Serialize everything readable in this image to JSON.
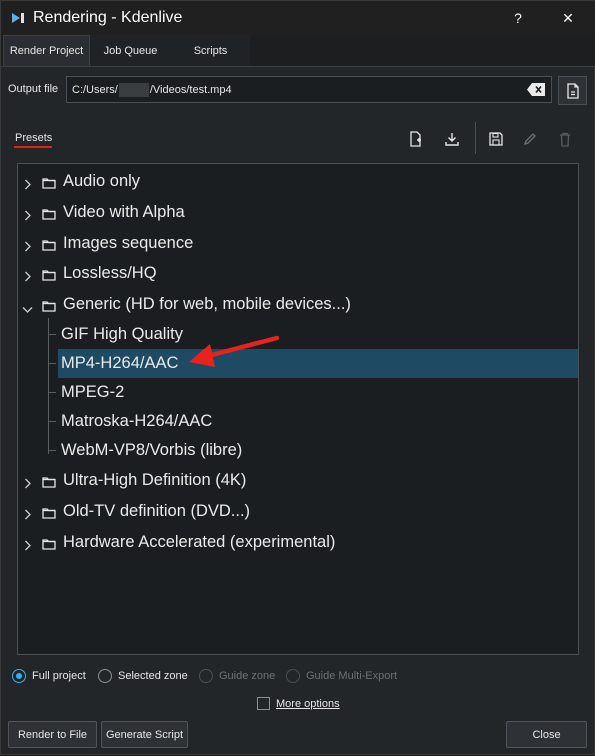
{
  "window": {
    "title": "Rendering - Kdenlive",
    "help_label": "?",
    "close_label": "✕"
  },
  "tabs": [
    {
      "label": "Render Project",
      "active": true
    },
    {
      "label": "Job Queue",
      "active": false
    },
    {
      "label": "Scripts",
      "active": false
    }
  ],
  "output": {
    "label": "Output file",
    "value_prefix": "C:/Users/",
    "value_suffix": "/Videos/test.mp4"
  },
  "presets": {
    "label": "Presets",
    "toolbar_icons": [
      "new-preset-icon",
      "download-preset-icon",
      "save-preset-icon",
      "edit-preset-icon",
      "delete-preset-icon"
    ],
    "groups": [
      {
        "label": "Audio only",
        "expanded": false
      },
      {
        "label": "Video with Alpha",
        "expanded": false
      },
      {
        "label": "Images sequence",
        "expanded": false
      },
      {
        "label": "Lossless/HQ",
        "expanded": false
      },
      {
        "label": "Generic (HD for web, mobile devices...)",
        "expanded": true,
        "children": [
          "GIF High Quality",
          "MP4-H264/AAC",
          "MPEG-2",
          "Matroska-H264/AAC",
          "WebM-VP8/Vorbis (libre)"
        ],
        "selected_child": "MP4-H264/AAC"
      },
      {
        "label": "Ultra-High Definition (4K)",
        "expanded": false
      },
      {
        "label": "Old-TV definition (DVD...)",
        "expanded": false
      },
      {
        "label": "Hardware Accelerated (experimental)",
        "expanded": false
      }
    ]
  },
  "colors": {
    "accent": "#3daee9",
    "selection": "#1f4a63",
    "annotation_arrow": "#e8231f"
  },
  "zone": {
    "options": [
      {
        "label": "Full project",
        "checked": true,
        "enabled": true
      },
      {
        "label": "Selected zone",
        "checked": false,
        "enabled": true
      },
      {
        "label": "Guide zone",
        "checked": false,
        "enabled": false
      },
      {
        "label": "Guide Multi-Export",
        "checked": false,
        "enabled": false
      }
    ]
  },
  "more_options": {
    "label": "More options",
    "checked": false
  },
  "buttons": {
    "render": "Render to File",
    "generate": "Generate Script",
    "close": "Close"
  }
}
